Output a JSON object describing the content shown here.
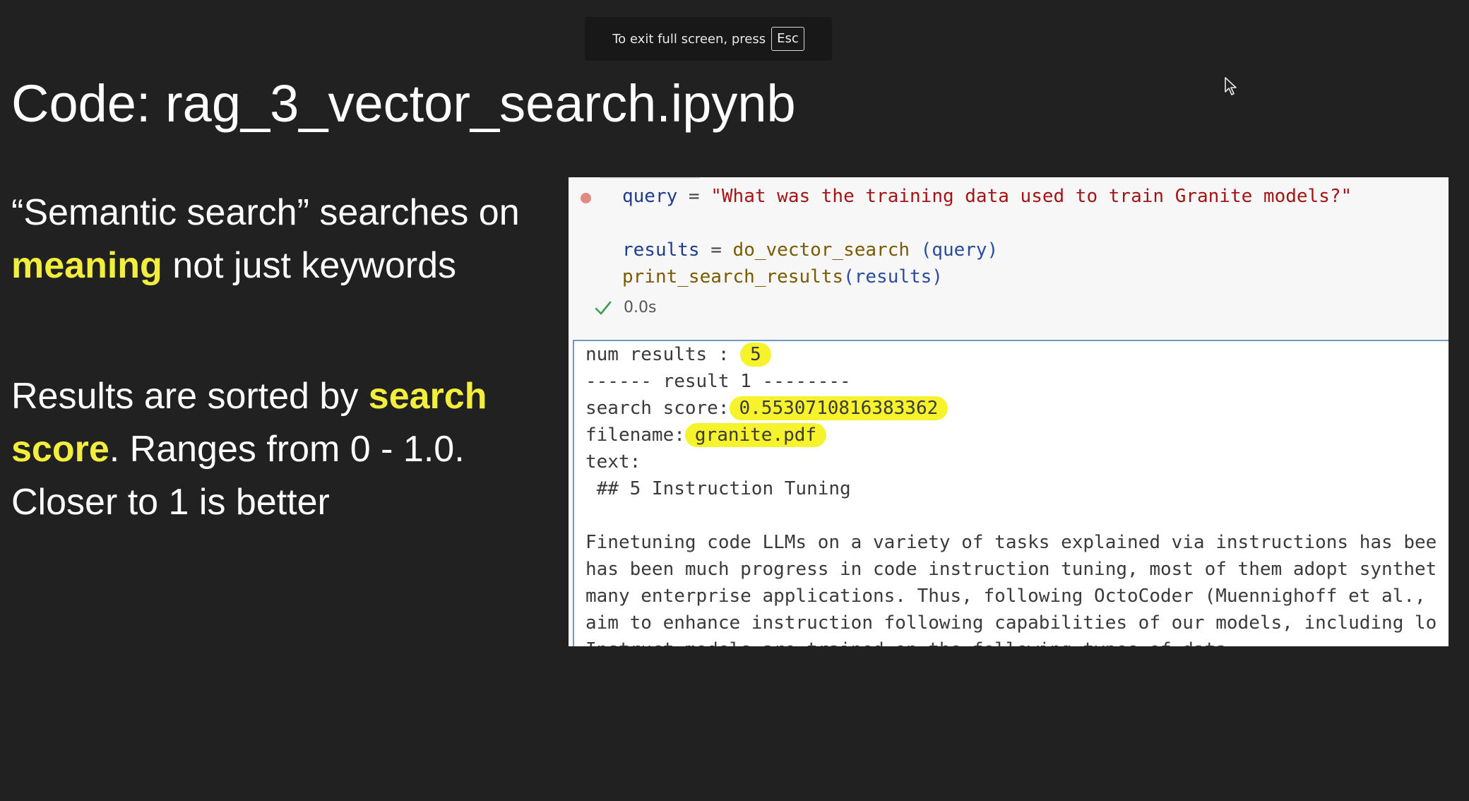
{
  "fullscreen_hint": {
    "text": "To exit full screen, press",
    "key": "Esc"
  },
  "slide": {
    "title": "Code: rag_3_vector_search.ipynb",
    "para1": {
      "a": "“Semantic search” searches on ",
      "b": "meaning",
      "c": " not just keywords"
    },
    "para2": {
      "a": "Results are sorted by ",
      "b": "search score",
      "c": ".  Ranges from 0 - 1.0. Closer to 1 is better"
    }
  },
  "notebook": {
    "code": {
      "line1_var": "query",
      "line1_op": " = ",
      "line1_str": "\"What was the training data used to train Granite models?\"",
      "line2_var": "results",
      "line2_op": " = ",
      "line2_fn": "do_vector_search",
      "line2_args": " (query)",
      "line3_fn": "print_search_results",
      "line3_args": "(results)"
    },
    "exec_time": "0.0s",
    "output": {
      "num_results_label": "num results : ",
      "num_results_value": "5",
      "result_header": "------ result 1 --------",
      "score_label": "search score:",
      "score_value": "0.5530710816383362",
      "filename_label": "filename:",
      "filename_value": "granite.pdf",
      "text_label": "text:",
      "heading": " ## 5 Instruction Tuning",
      "lines": [
        "Finetuning code LLMs on a variety of tasks explained via instructions has bee",
        "has been much progress in code instruction tuning, most of them adopt synthet",
        "many enterprise applications. Thus, following OctoCoder (Muennighoff et al.,",
        "aim to enhance instruction following capabilities of our models, including lo",
        "Instruct models are trained on the following types of data"
      ]
    }
  },
  "colors": {
    "background": "#212121",
    "highlight": "#f3ee3c",
    "marker": "#f6f22c"
  }
}
